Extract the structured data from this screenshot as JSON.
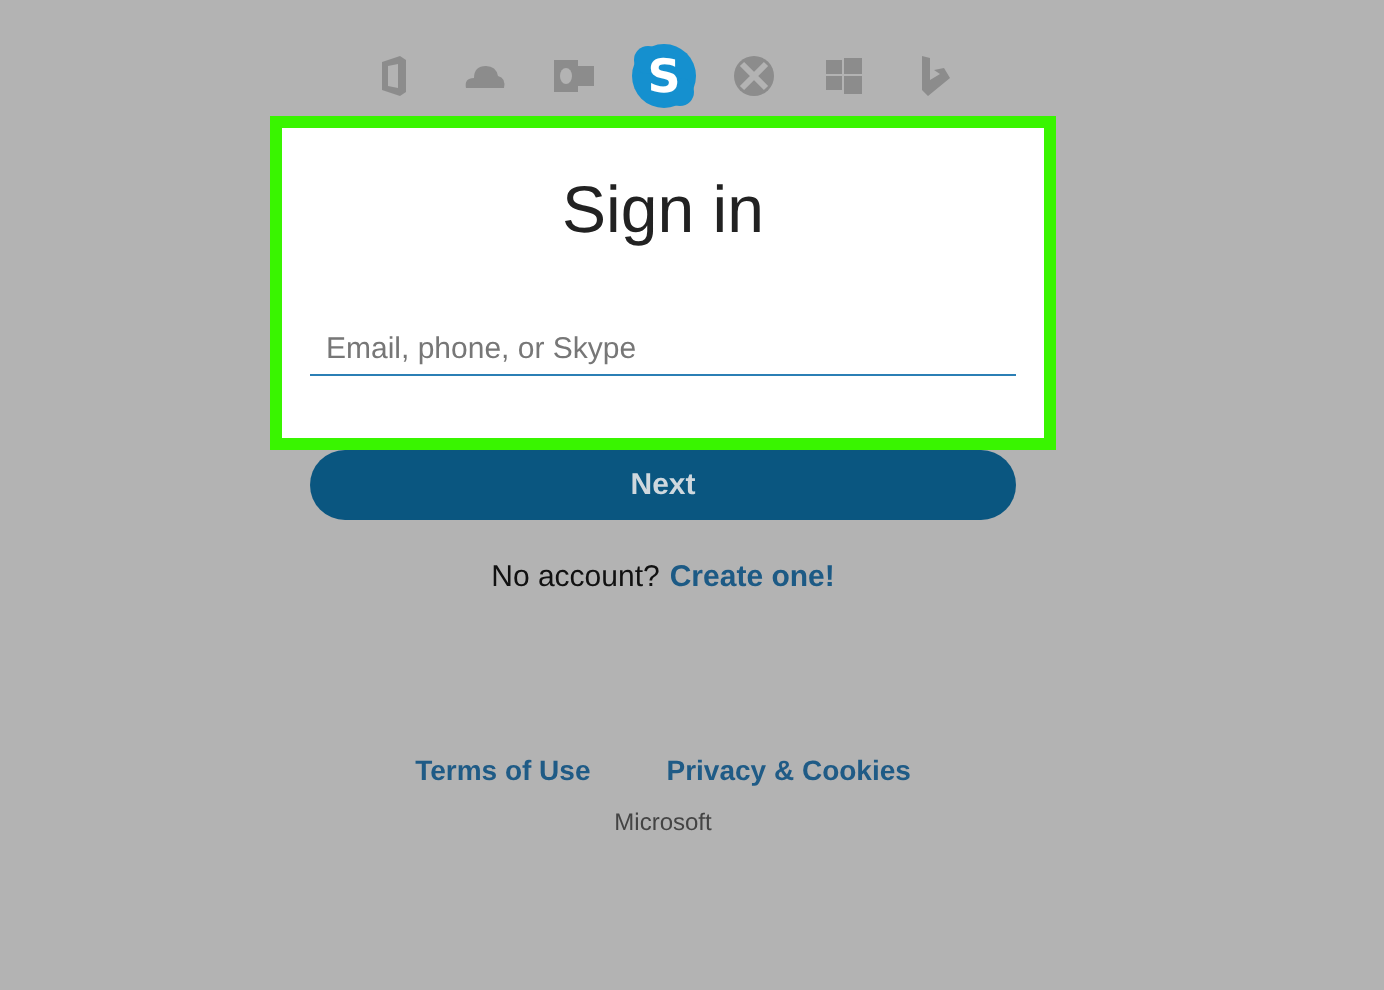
{
  "app_icons": [
    {
      "kind": "office",
      "selected": false
    },
    {
      "kind": "cloud",
      "selected": false
    },
    {
      "kind": "outlook",
      "selected": false
    },
    {
      "kind": "skype",
      "selected": true,
      "label": "S"
    },
    {
      "kind": "xbox",
      "selected": false
    },
    {
      "kind": "windows",
      "selected": false
    },
    {
      "kind": "bing",
      "selected": false
    }
  ],
  "card": {
    "title": "Sign in",
    "field": {
      "placeholder": "Email, phone, or Skype"
    }
  },
  "next_button": "Next",
  "signup": {
    "text": "No account?",
    "link": "Create one!"
  },
  "footer": {
    "links": [
      "Terms of Use",
      "Privacy & Cookies"
    ],
    "brand": "Microsoft"
  }
}
